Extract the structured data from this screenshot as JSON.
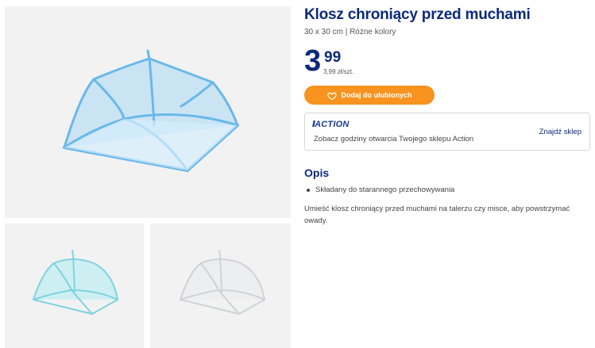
{
  "product": {
    "title": "Klosz chroniący przed muchami",
    "subtitle": "30 x 30 cm | Różne kolory",
    "price_integer": "3",
    "price_decimal": "99",
    "unit_price": "3,99 zł/szt.",
    "favorite_button_label": "Dodaj do ulubionych",
    "favorite_icon": "heart-icon"
  },
  "store": {
    "logo_text": "ACTION",
    "info_text": "Zobacz godziny otwarcia Twojego sklepu Action",
    "link_label": "Znajdź sklep"
  },
  "description": {
    "heading": "Opis",
    "bullets": [
      "Składany do starannego przechowywania"
    ],
    "text": "Umieść klosz chroniący przed muchami na talerzu czy misce, aby powstrzymać owady."
  },
  "images": {
    "main_color": "#8cc8ee",
    "thumb1_color": "#8fdde6",
    "thumb2_color": "#e4e6ea"
  },
  "colors": {
    "brand_blue": "#0b2a7a",
    "accent_orange": "#f7931e"
  }
}
